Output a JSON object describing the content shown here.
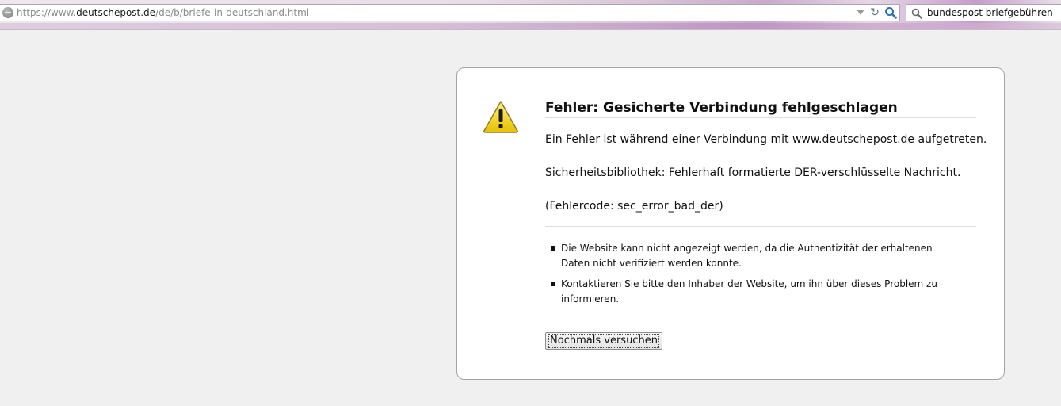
{
  "toolbar": {
    "url_prefix": "https://www.",
    "url_host": "deutschepost.de",
    "url_path": "/de/b/briefe-in-deutschland.html",
    "search_value": "bundespost briefgebühren"
  },
  "icons": {
    "site": "globe-icon",
    "dropdown": "chevron-down-icon",
    "reload": "reload-icon",
    "go": "magnifier-icon",
    "search": "search-icon",
    "warning": "warning-triangle-icon"
  },
  "error": {
    "title": "Fehler: Gesicherte Verbindung fehlgeschlagen",
    "message_1": "Ein Fehler ist während einer Verbindung mit www.deutschepost.de aufgetreten.",
    "message_2": "Sicherheitsbibliothek: Fehlerhaft formatierte DER-verschlüsselte Nachricht.",
    "message_3": "(Fehlercode: sec_error_bad_der)",
    "bullets": [
      "Die Website kann nicht angezeigt werden, da die Authentizität der erhaltenen Daten nicht verifiziert werden konnte.",
      "Kontaktieren Sie bitte den Inhaber der Website, um ihn über dieses Problem zu informieren."
    ],
    "retry_label": "Nochmals versuchen"
  },
  "colors": {
    "page_background": "#f0f0f0",
    "box_background": "#ffffff",
    "warning_yellow": "#f4d21a"
  }
}
